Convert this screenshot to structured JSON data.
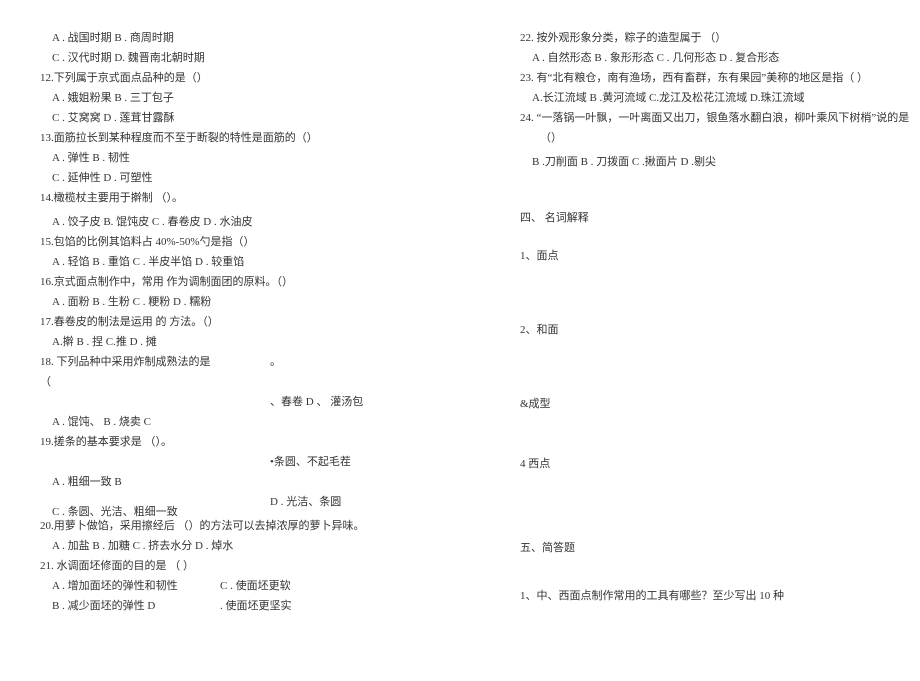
{
  "left": {
    "q11_opt1": "A . 战国时期 B . 商周时期",
    "q11_opt2": "C . 汉代时期 D. 魏晋南北朝时期",
    "q12": "12.下列属于京式面点品种的是（）",
    "q12_opt1": "A . 娥姐粉果 B . 三丁包子",
    "q12_opt2": "C . 艾窝窝 D . 莲茸甘露酥",
    "q13": "13.面筋拉长到某种程度而不至于断裂的特性是面筋的（）",
    "q13_opt1": "A . 弹性  B . 韧性",
    "q13_opt2": "C . 延伸性  D . 可塑性",
    "q14": "14.橄榄杖主要用于擀制 （）。",
    "q14_opt1": "A . 饺子皮  B. 馄饨皮 C . 春卷皮  D . 水油皮",
    "q15": "15.包馅的比例其馅料占 40%-50%勺是指（）",
    "q15_opt1": "A . 轻馅  B . 重馅  C . 半皮半馅  D . 较重馅",
    "q16": "16.京式面点制作中，常用  作为调制面团的原料。（）",
    "q16_opt1": "A . 面粉  B . 生粉  C . 粳粉  D . 糯粉",
    "q17": "17.春卷皮的制法是运用  的 方法。（）",
    "q17_opt1": "A.擀  B . 捏  C.推  D . 摊",
    "q18": "18. 下列品种中采用炸制成熟法的是",
    "q18_blank": "。",
    "q18_paren": "（",
    "q18_opt_right": "、春卷  D 、 灌汤包",
    "q18_opt_left": "A . 馄饨、  B . 烧卖  C",
    "q19": "19.搓条的基本要求是 （）。",
    "q19_dot_right": "•条圆、不起毛茬",
    "q19_opt_left": "A . 粗细一致 B",
    "q19_opt_right2": "D . 光洁、条圆",
    "q19_c_line": "C . 条圆、光洁、粗细一致",
    "q20": "20.用萝卜做馅，采用擦经后 （）的方法可以去掉浓厚的萝卜异味。",
    "q20_opt1": "A . 加盐  B . 加糖  C . 挤去水分  D . 焯水",
    "q21": "21. 水调面坯修面的目的是 （ ）",
    "q21_opt_a": "A . 增加面坯的弹性和韧性",
    "q21_opt_c": "C . 使面坯更软",
    "q21_opt_b": "B . 减少面坯的弹性 D",
    "q21_opt_d": ". 使面坯更坚实"
  },
  "right": {
    "q22": "22. 按外观形象分类，粽子的造型属于 （）",
    "q22_opt": "A . 自然形态  B . 象形形态  C . 几何形态  D . 复合形态",
    "q23": "23. 有“北有粮仓，南有渔场，西有畜群，东有果园”美称的地区是指（ ）",
    "q23_opt": "A.长江流域 B .黄河流域  C.龙江及松花江流域 D.珠江流域",
    "q24": "24. “一落锅一叶飘，一叶离面又出刀，银鱼落水翻白浪，柳叶乘风下树梢”说的是",
    "q24_paren": "（）",
    "q24_opt": "B .刀削面 B . 刀拨面  C .揪面片  D .剔尖",
    "sec4": "四、 名词解释",
    "sec4_1": "1、面点",
    "sec4_2": "2、和面",
    "sec4_3": "&成型",
    "sec4_4": "4 西点",
    "sec5": "五、简答题",
    "sec5_1": "1、中、西面点制作常用的工具有哪些？至少写出  10 种"
  }
}
